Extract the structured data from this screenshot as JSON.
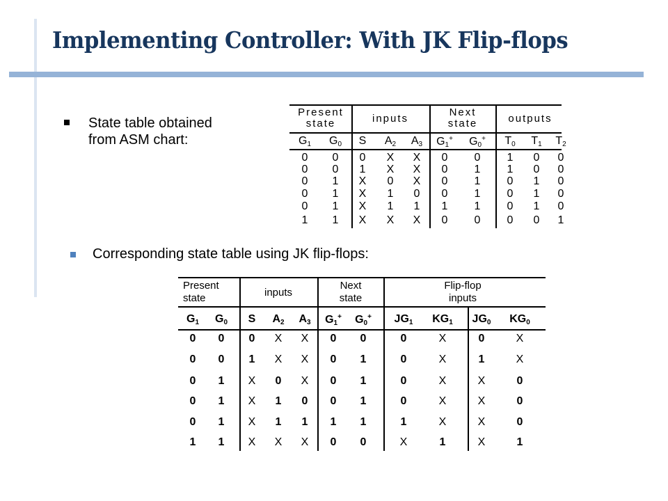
{
  "slide": {
    "title": "Implementing Controller: With JK Flip-flops",
    "accent_colors": {
      "title": "#17365d",
      "bar": "#95b3d7",
      "vline": "#dbe5f1",
      "bullet2": "#4f81bd"
    }
  },
  "bullets": [
    {
      "text": "State table obtained from ASM chart:"
    },
    {
      "text": "Corresponding state table using JK flip-flops:"
    }
  ],
  "table1": {
    "group_headers": [
      "Present state",
      "inputs",
      "Next state",
      "outputs"
    ],
    "columns": [
      {
        "base": "G",
        "sub": "1",
        "sup": ""
      },
      {
        "base": "G",
        "sub": "0",
        "sup": ""
      },
      {
        "base": "S",
        "sub": "",
        "sup": ""
      },
      {
        "base": "A",
        "sub": "2",
        "sup": ""
      },
      {
        "base": "A",
        "sub": "3",
        "sup": ""
      },
      {
        "base": "G",
        "sub": "1",
        "sup": "+"
      },
      {
        "base": "G",
        "sub": "0",
        "sup": "+"
      },
      {
        "base": "T",
        "sub": "0",
        "sup": ""
      },
      {
        "base": "T",
        "sub": "1",
        "sup": ""
      },
      {
        "base": "T",
        "sub": "2",
        "sup": ""
      }
    ],
    "rows": [
      [
        "0",
        "0",
        "0",
        "X",
        "X",
        "0",
        "0",
        "1",
        "0",
        "0"
      ],
      [
        "0",
        "0",
        "1",
        "X",
        "X",
        "0",
        "1",
        "1",
        "0",
        "0"
      ],
      [
        "0",
        "1",
        "X",
        "0",
        "X",
        "0",
        "1",
        "0",
        "1",
        "0"
      ],
      [
        "0",
        "1",
        "X",
        "1",
        "0",
        "0",
        "1",
        "0",
        "1",
        "0"
      ],
      [
        "0",
        "1",
        "X",
        "1",
        "1",
        "1",
        "1",
        "0",
        "1",
        "0"
      ],
      [
        "1",
        "1",
        "X",
        "X",
        "X",
        "0",
        "0",
        "0",
        "0",
        "1"
      ]
    ]
  },
  "table2": {
    "group_headers": [
      "Present state",
      "inputs",
      "Next state",
      "Flip-flop inputs"
    ],
    "columns": [
      {
        "base": "G",
        "sub": "1",
        "sup": ""
      },
      {
        "base": "G",
        "sub": "0",
        "sup": ""
      },
      {
        "base": "S",
        "sub": "",
        "sup": ""
      },
      {
        "base": "A",
        "sub": "2",
        "sup": ""
      },
      {
        "base": "A",
        "sub": "3",
        "sup": ""
      },
      {
        "base": "G",
        "sub": "1",
        "sup": "+"
      },
      {
        "base": "G",
        "sub": "0",
        "sup": "+"
      },
      {
        "base": "JG",
        "sub": "1",
        "sup": ""
      },
      {
        "base": "KG",
        "sub": "1",
        "sup": ""
      },
      {
        "base": "JG",
        "sub": "0",
        "sup": ""
      },
      {
        "base": "KG",
        "sub": "0",
        "sup": ""
      }
    ],
    "rows": [
      [
        "0",
        "0",
        "0",
        "X",
        "X",
        "0",
        "0",
        "0",
        "X",
        "0",
        "X"
      ],
      [
        "0",
        "0",
        "1",
        "X",
        "X",
        "0",
        "1",
        "0",
        "X",
        "1",
        "X"
      ],
      [
        "0",
        "1",
        "X",
        "0",
        "X",
        "0",
        "1",
        "0",
        "X",
        "X",
        "0"
      ],
      [
        "0",
        "1",
        "X",
        "1",
        "0",
        "0",
        "1",
        "0",
        "X",
        "X",
        "0"
      ],
      [
        "0",
        "1",
        "X",
        "1",
        "1",
        "1",
        "1",
        "1",
        "X",
        "X",
        "0"
      ],
      [
        "1",
        "1",
        "X",
        "X",
        "X",
        "0",
        "0",
        "X",
        "1",
        "X",
        "1"
      ]
    ]
  }
}
